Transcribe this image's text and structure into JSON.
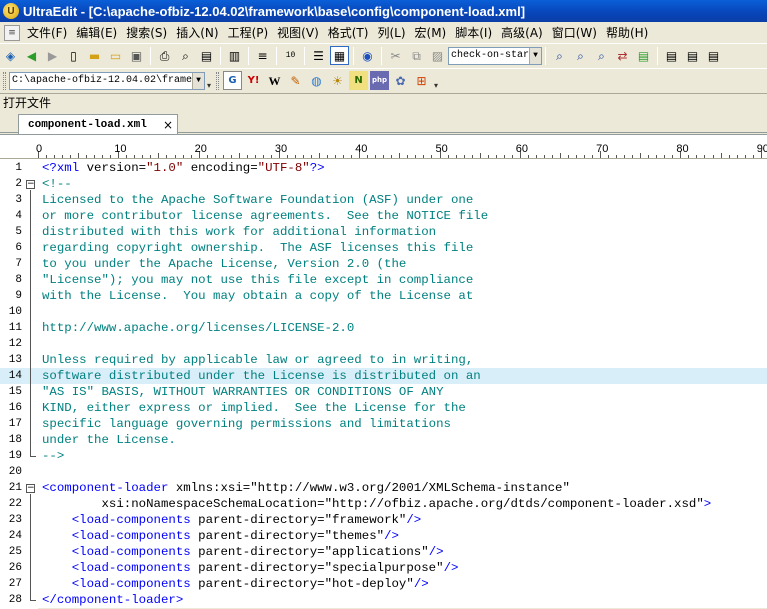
{
  "window": {
    "title": "UltraEdit - [C:\\apache-ofbiz-12.04.02\\framework\\base\\config\\component-load.xml]"
  },
  "menu": [
    "文件(F)",
    "编辑(E)",
    "搜索(S)",
    "插入(N)",
    "工程(P)",
    "视图(V)",
    "格式(T)",
    "列(L)",
    "宏(M)",
    "脚本(I)",
    "高级(A)",
    "窗口(W)",
    "帮助(H)"
  ],
  "toolbar1": {
    "combo_value": "check-on-star"
  },
  "toolbar2": {
    "path_combo": "C:\\apache-ofbiz-12.04.02\\frame"
  },
  "panel": {
    "label": "打开文件"
  },
  "tab": {
    "label": "component-load.xml",
    "close": "×"
  },
  "ruler": {
    "labels": [
      "0",
      "10",
      "20",
      "30",
      "40",
      "50",
      "60",
      "70",
      "80",
      "90"
    ]
  },
  "editor": {
    "highlight_line": 14,
    "lines": [
      {
        "n": "1",
        "segs": [
          [
            "tag",
            "<?xml "
          ],
          [
            "attr",
            "version="
          ],
          [
            "str",
            "\"1.0\""
          ],
          [
            "attr",
            " encoding="
          ],
          [
            "str",
            "\"UTF-8\""
          ],
          [
            "tag",
            "?>"
          ]
        ]
      },
      {
        "n": "2",
        "segs": [
          [
            "comment",
            "<!--"
          ]
        ]
      },
      {
        "n": "3",
        "segs": [
          [
            "comment",
            "Licensed to the Apache Software Foundation (ASF) under one"
          ]
        ]
      },
      {
        "n": "4",
        "segs": [
          [
            "comment",
            "or more contributor license agreements.  See the NOTICE file"
          ]
        ]
      },
      {
        "n": "5",
        "segs": [
          [
            "comment",
            "distributed with this work for additional information"
          ]
        ]
      },
      {
        "n": "6",
        "segs": [
          [
            "comment",
            "regarding copyright ownership.  The ASF licenses this file"
          ]
        ]
      },
      {
        "n": "7",
        "segs": [
          [
            "comment",
            "to you under the Apache License, Version 2.0 (the"
          ]
        ]
      },
      {
        "n": "8",
        "segs": [
          [
            "comment",
            "\"License\"); you may not use this file except in compliance"
          ]
        ]
      },
      {
        "n": "9",
        "segs": [
          [
            "comment",
            "with the License.  You may obtain a copy of the License at"
          ]
        ]
      },
      {
        "n": "10",
        "segs": [
          [
            "comment",
            ""
          ]
        ]
      },
      {
        "n": "11",
        "segs": [
          [
            "comment",
            "http://www.apache.org/licenses/LICENSE-2.0"
          ]
        ]
      },
      {
        "n": "12",
        "segs": [
          [
            "comment",
            ""
          ]
        ]
      },
      {
        "n": "13",
        "segs": [
          [
            "comment",
            "Unless required by applicable law or agreed to in writing,"
          ]
        ]
      },
      {
        "n": "14",
        "segs": [
          [
            "comment",
            "software distributed under the License is distributed on an"
          ]
        ]
      },
      {
        "n": "15",
        "segs": [
          [
            "comment",
            "\"AS IS\" BASIS, WITHOUT WARRANTIES OR CONDITIONS OF ANY"
          ]
        ]
      },
      {
        "n": "16",
        "segs": [
          [
            "comment",
            "KIND, either express or implied.  See the License for the"
          ]
        ]
      },
      {
        "n": "17",
        "segs": [
          [
            "comment",
            "specific language governing permissions and limitations"
          ]
        ]
      },
      {
        "n": "18",
        "segs": [
          [
            "comment",
            "under the License."
          ]
        ]
      },
      {
        "n": "19",
        "segs": [
          [
            "comment",
            "-->"
          ]
        ]
      },
      {
        "n": "20",
        "segs": []
      },
      {
        "n": "21",
        "segs": [
          [
            "tag",
            "<component-loader"
          ],
          [
            "attr",
            " xmlns:xsi="
          ],
          [
            "val",
            "\"http://www.w3.org/2001/XMLSchema-instance\""
          ]
        ]
      },
      {
        "n": "22",
        "segs": [
          [
            "attr",
            "        xsi:noNamespaceSchemaLocation="
          ],
          [
            "val",
            "\"http://ofbiz.apache.org/dtds/component-loader.xsd\""
          ],
          [
            "tag",
            ">"
          ]
        ]
      },
      {
        "n": "23",
        "segs": [
          [
            "attr",
            "    "
          ],
          [
            "tag",
            "<load-components"
          ],
          [
            "attr",
            " parent-directory="
          ],
          [
            "val",
            "\"framework\""
          ],
          [
            "tag",
            "/>"
          ]
        ]
      },
      {
        "n": "24",
        "segs": [
          [
            "attr",
            "    "
          ],
          [
            "tag",
            "<load-components"
          ],
          [
            "attr",
            " parent-directory="
          ],
          [
            "val",
            "\"themes\""
          ],
          [
            "tag",
            "/>"
          ]
        ]
      },
      {
        "n": "25",
        "segs": [
          [
            "attr",
            "    "
          ],
          [
            "tag",
            "<load-components"
          ],
          [
            "attr",
            " parent-directory="
          ],
          [
            "val",
            "\"applications\""
          ],
          [
            "tag",
            "/>"
          ]
        ]
      },
      {
        "n": "26",
        "segs": [
          [
            "attr",
            "    "
          ],
          [
            "tag",
            "<load-components"
          ],
          [
            "attr",
            " parent-directory="
          ],
          [
            "val",
            "\"specialpurpose\""
          ],
          [
            "tag",
            "/>"
          ]
        ]
      },
      {
        "n": "27",
        "segs": [
          [
            "attr",
            "    "
          ],
          [
            "tag",
            "<load-components"
          ],
          [
            "attr",
            " parent-directory="
          ],
          [
            "val",
            "\"hot-deploy\""
          ],
          [
            "tag",
            "/>"
          ]
        ]
      },
      {
        "n": "28",
        "segs": [
          [
            "tag",
            "</component-loader>"
          ]
        ]
      }
    ]
  },
  "colors": {
    "titlebar": "#0a5fd8",
    "comment": "#008080",
    "tag": "#0000ff",
    "string": "#800000",
    "highlight": "#d8eef8"
  }
}
